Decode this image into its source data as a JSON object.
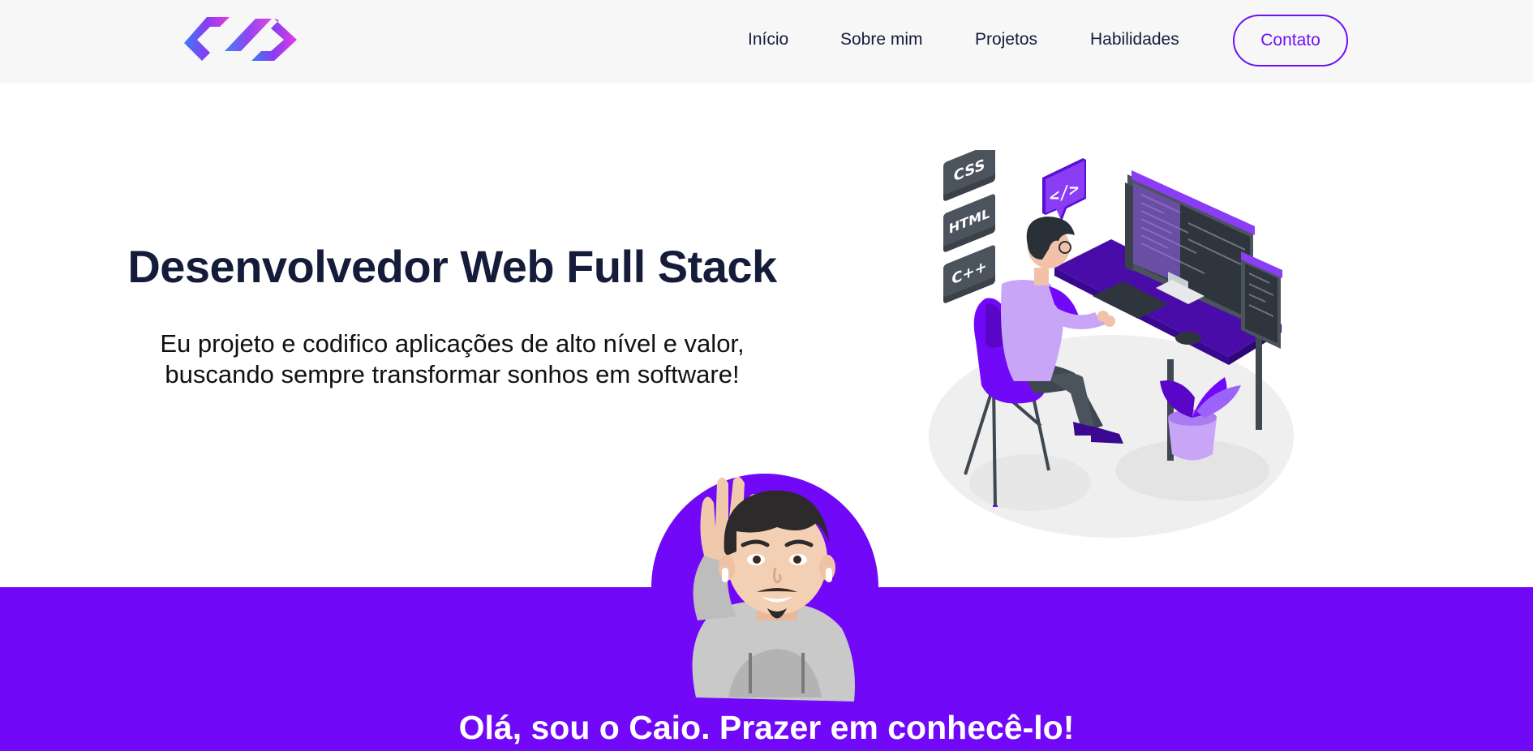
{
  "nav": {
    "logo_icon": "code-brackets-logo",
    "links": [
      {
        "label": "Início"
      },
      {
        "label": "Sobre mim"
      },
      {
        "label": "Projetos"
      },
      {
        "label": "Habilidades"
      }
    ],
    "contact_label": "Contato"
  },
  "hero": {
    "title": "Desenvolvedor Web Full Stack",
    "line1": "Eu projeto e codifico aplicações de alto nível e valor,",
    "line2": "buscando sempre transformar sonhos em software!",
    "illustration": {
      "badges": [
        "CSS",
        "HTML",
        "C++"
      ],
      "code_bubble": "</>"
    }
  },
  "about": {
    "greeting": "Olá, sou o Caio. Prazer em conhecê-lo!"
  },
  "colors": {
    "accent": "#7108f7",
    "text_dark": "#141c3a",
    "nav_bg": "#f7f7f7"
  }
}
